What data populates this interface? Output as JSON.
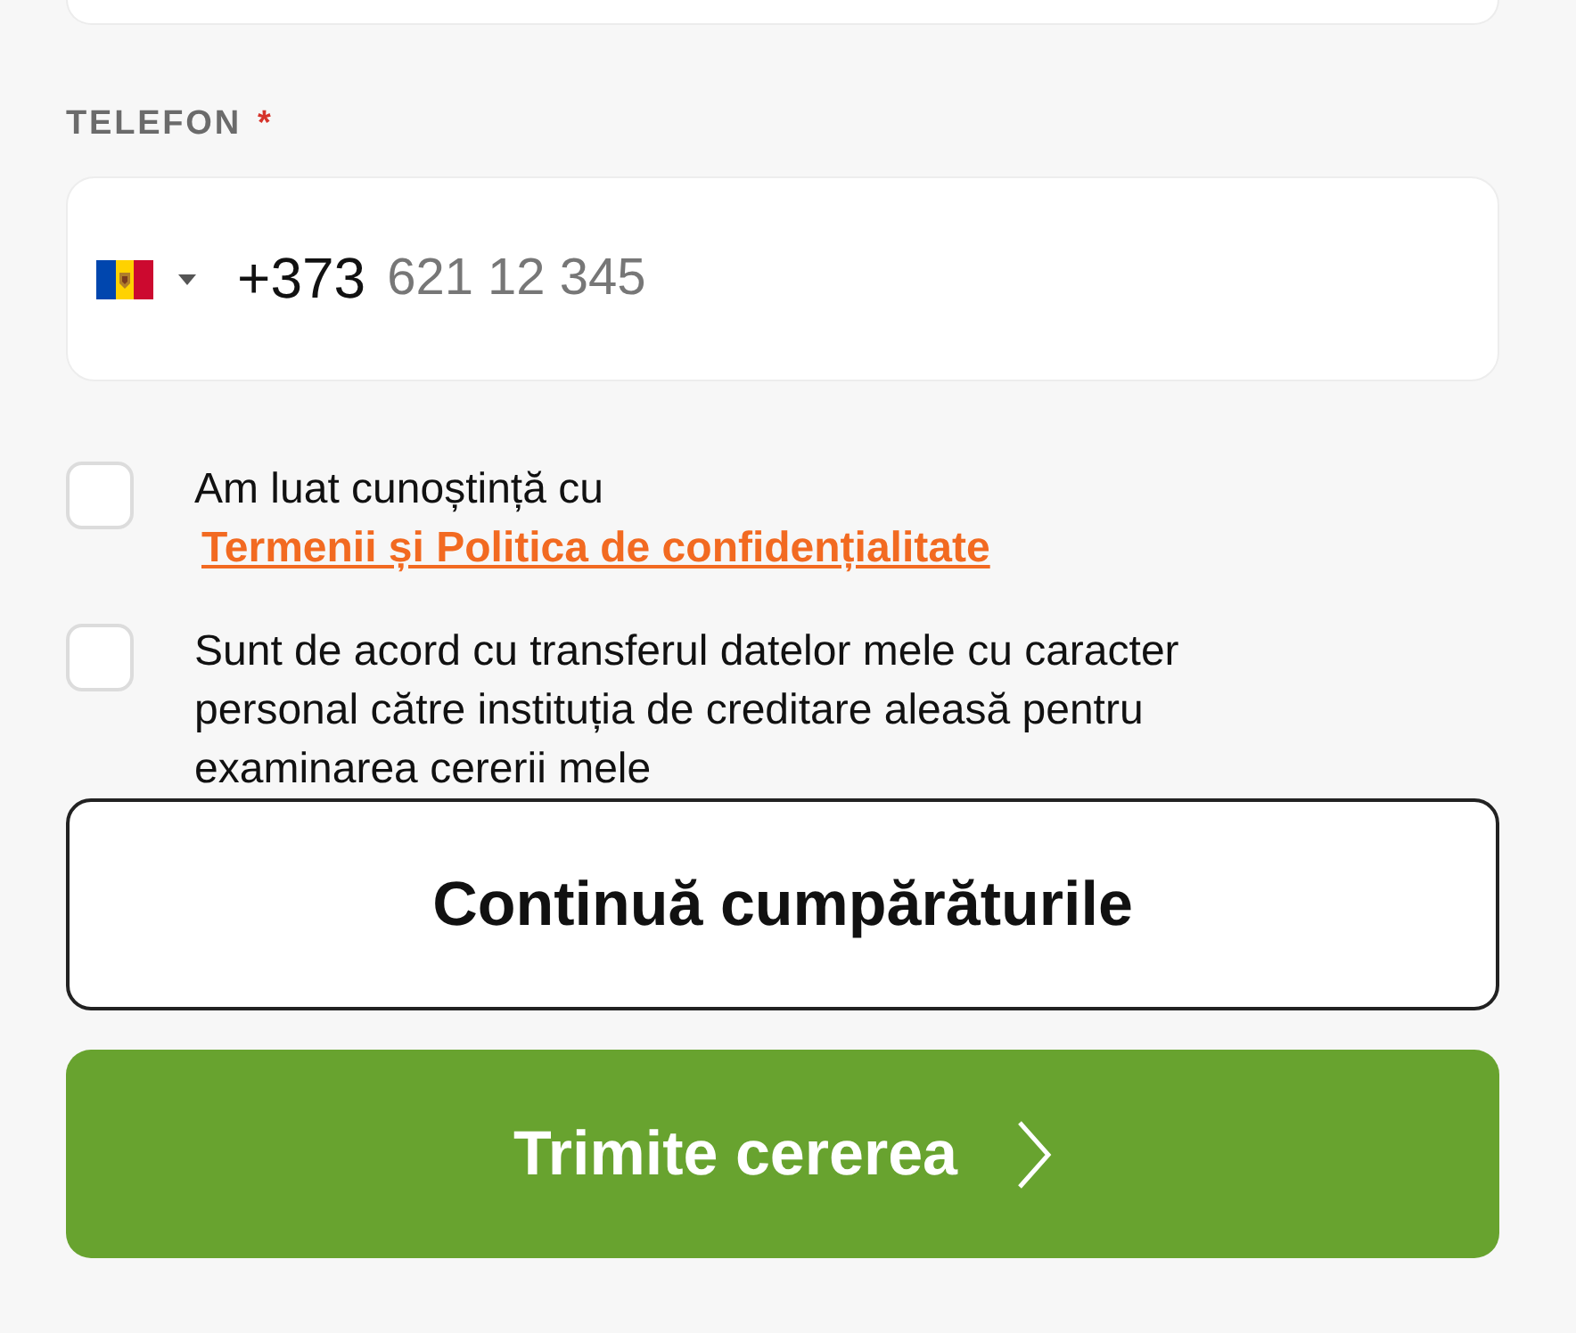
{
  "fields": [
    {
      "kind": "text"
    },
    {
      "kind": "phone",
      "label": "TELEFON",
      "required_mark": "*",
      "country_code": "+373",
      "placeholder": "621 12 345"
    }
  ],
  "consents": [
    {
      "checked": false,
      "text": "Am luat cunoștință cu",
      "link": "Termenii și Politica de confidențialitate"
    },
    {
      "checked": false,
      "text": "Sunt de acord cu transferul datelor mele cu caracter personal către instituția de creditare aleasă pentru examinarea cererii mele"
    }
  ],
  "buttons": [
    {
      "kind": "secondary",
      "label": "Continuă cumpărăturile"
    },
    {
      "kind": "primary",
      "label": "Trimite cererea"
    }
  ]
}
